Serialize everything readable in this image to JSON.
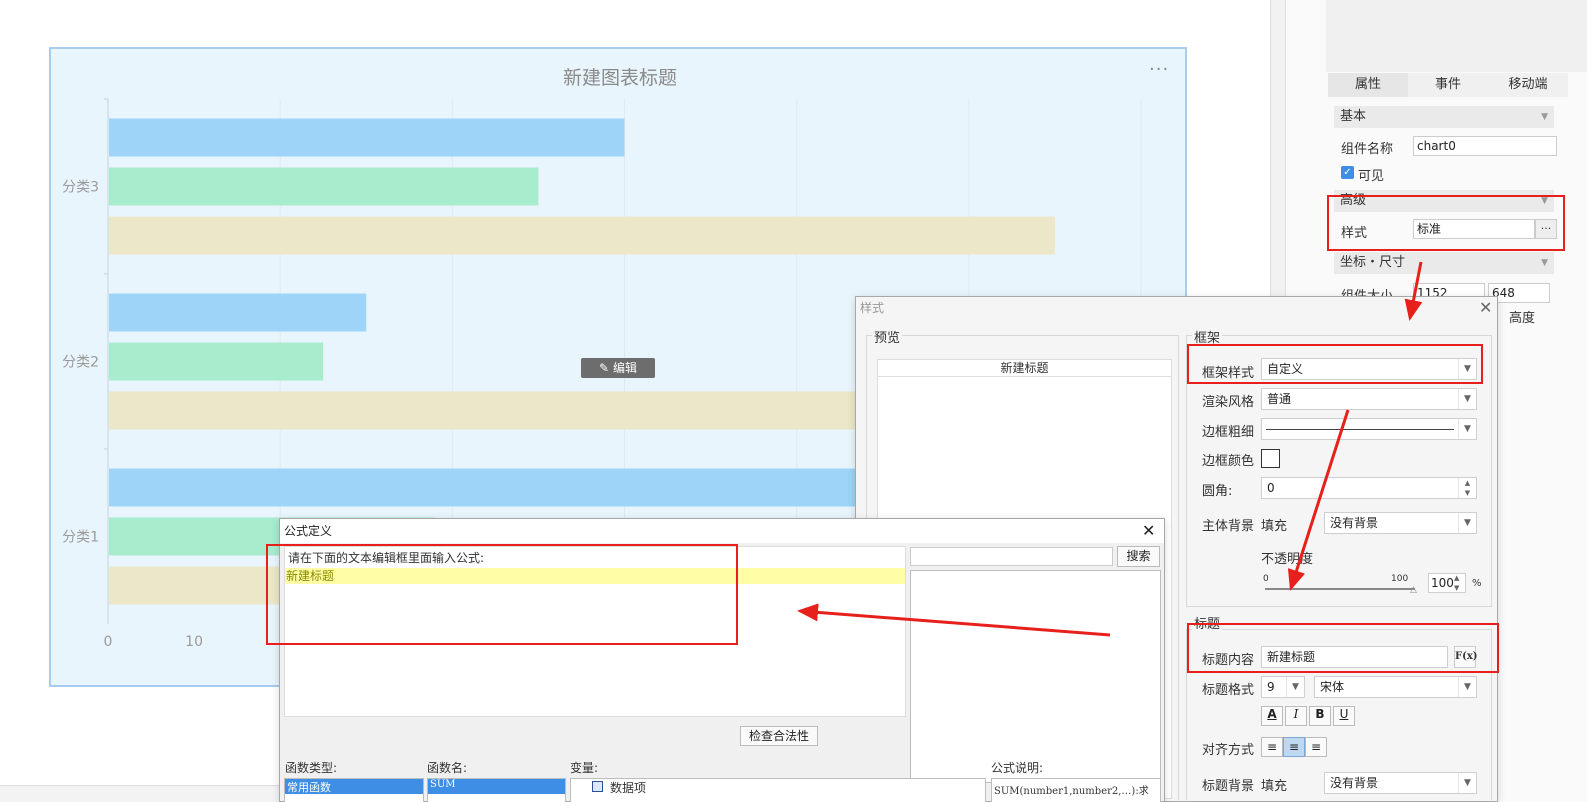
{
  "chart_data": {
    "type": "bar",
    "title": "新建图表标题",
    "categories": [
      "分类3",
      "分类2",
      "分类1"
    ],
    "series": [
      {
        "values": [
          60,
          30,
          110
        ],
        "color": "#9dd4f7"
      },
      {
        "values": [
          50,
          25,
          38
        ],
        "color": "#a8ecce"
      },
      {
        "values": [
          110,
          94,
          90
        ],
        "color": "#ebe7c8"
      }
    ],
    "xlim": [
      0,
      120
    ],
    "x_ticks": [
      "0",
      "10"
    ],
    "orientation": "horizontal",
    "grid": true
  },
  "canvas": {
    "menu_icon": "···",
    "edit_label": "编辑"
  },
  "panel": {
    "tabs": [
      "属性",
      "事件",
      "移动端"
    ],
    "basic": "基本",
    "name_label": "组件名称",
    "name_value": "chart0",
    "visible_label": "可见",
    "advanced": "高级",
    "style_label": "样式",
    "style_value": "标准",
    "style_btn": "···",
    "coord": "坐标・尺寸",
    "size_label": "组件大小",
    "width_value": "1152",
    "height_value": "648",
    "height_label": "高度"
  },
  "style_dialog": {
    "title": "样式",
    "preview": "预览",
    "preview_title": "新建标题",
    "frame_group": "框架",
    "frame_style_label": "框架样式",
    "frame_style_value": "自定义",
    "render_label": "渲染风格",
    "render_value": "普通",
    "border_width_label": "边框粗细",
    "border_color_label": "边框颜色",
    "radius_label": "圆角:",
    "radius_value": "0",
    "bg_label": "主体背景",
    "fill_label": "填充",
    "bg_value": "没有背景",
    "opacity_label": "不透明度",
    "slider_min": "0",
    "slider_max": "100",
    "opacity_value": "100",
    "opacity_unit": "%",
    "opacity_level": 1.0,
    "title_group": "标题",
    "title_content_label": "标题内容",
    "title_content_value": "新建标题",
    "fx_label": "F(x)",
    "title_format_label": "标题格式",
    "font_size": "9",
    "font_name": "宋体",
    "fmt_buttons": [
      "A",
      "I",
      "B",
      "U"
    ],
    "align_label": "对齐方式",
    "title_bg_label": "标题背景",
    "title_fill_label": "填充",
    "title_bg_value": "没有背景"
  },
  "formula_dialog": {
    "title": "公式定义",
    "instruction": "请在下面的文本编辑框里面输入公式:",
    "formula_text": "新建标题",
    "search_btn": "搜索",
    "search_value": "",
    "check_btn": "检查合法性",
    "func_type_label": "函数类型:",
    "func_type_selected": "常用函数",
    "func_name_label": "函数名:",
    "func_name_selected": "SUM",
    "var_label": "变量:",
    "var_item": "数据项",
    "desc_label": "公式说明:",
    "desc_text": "SUM(number1,number2,…):求"
  },
  "colors": {
    "highlight": "#e8201c",
    "accent": "#3d8ee4"
  }
}
